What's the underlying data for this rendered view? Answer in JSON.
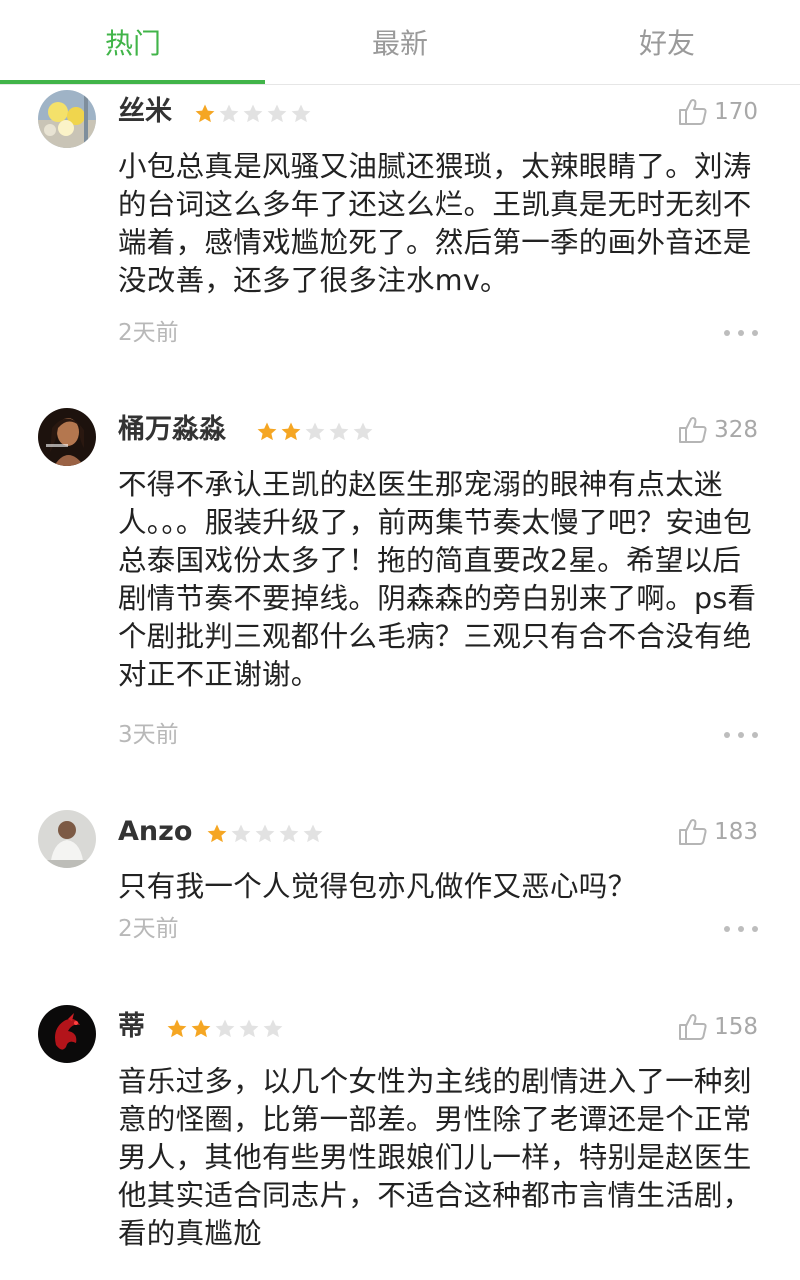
{
  "tabs": [
    {
      "label": "热门",
      "active": true
    },
    {
      "label": "最新",
      "active": false
    },
    {
      "label": "好友",
      "active": false
    }
  ],
  "colors": {
    "accent": "#41b449",
    "star_on": "#f5a623",
    "star_off": "#e2e2e2",
    "muted": "#b8b8b8"
  },
  "comments": [
    {
      "name": "丝米",
      "rating": 1,
      "likes": "170",
      "text": "小包总真是风骚又油腻还猥琐，太辣眼睛了。刘涛的台词这么多年了还这么烂。王凯真是无时无刻不端着，感情戏尴尬死了。然后第一季的画外音还是没改善，还多了很多注水mv。",
      "time": "2天前",
      "avatar": "flowers-avatar"
    },
    {
      "name": "桶万淼淼",
      "rating": 2,
      "likes": "328",
      "text": "不得不承认王凯的赵医生那宠溺的眼神有点太迷人。。。服装升级了，前两集节奏太慢了吧？安迪包总泰国戏份太多了！拖的简直要改2星。希望以后剧情节奏不要掉线。阴森森的旁白别来了啊。ps看个剧批判三观都什么毛病？三观只有合不合没有绝对正不正谢谢。",
      "time": "3天前",
      "avatar": "woman-portrait-avatar"
    },
    {
      "name": "Anzo",
      "rating": 1,
      "likes": "183",
      "text": "只有我一个人觉得包亦凡做作又恶心吗？",
      "time": "2天前",
      "avatar": "man-white-shirt-avatar"
    },
    {
      "name": "蒂",
      "rating": 2,
      "likes": "158",
      "text": "音乐过多，以几个女性为主线的剧情进入了一种刻意的怪圈，比第一部差。男性除了老谭还是个正常男人，其他有些男性跟娘们儿一样，特别是赵医生他其实适合同志片，不适合这种都市言情生活剧，看的真尴尬",
      "time": "",
      "avatar": "red-dragon-avatar"
    }
  ]
}
